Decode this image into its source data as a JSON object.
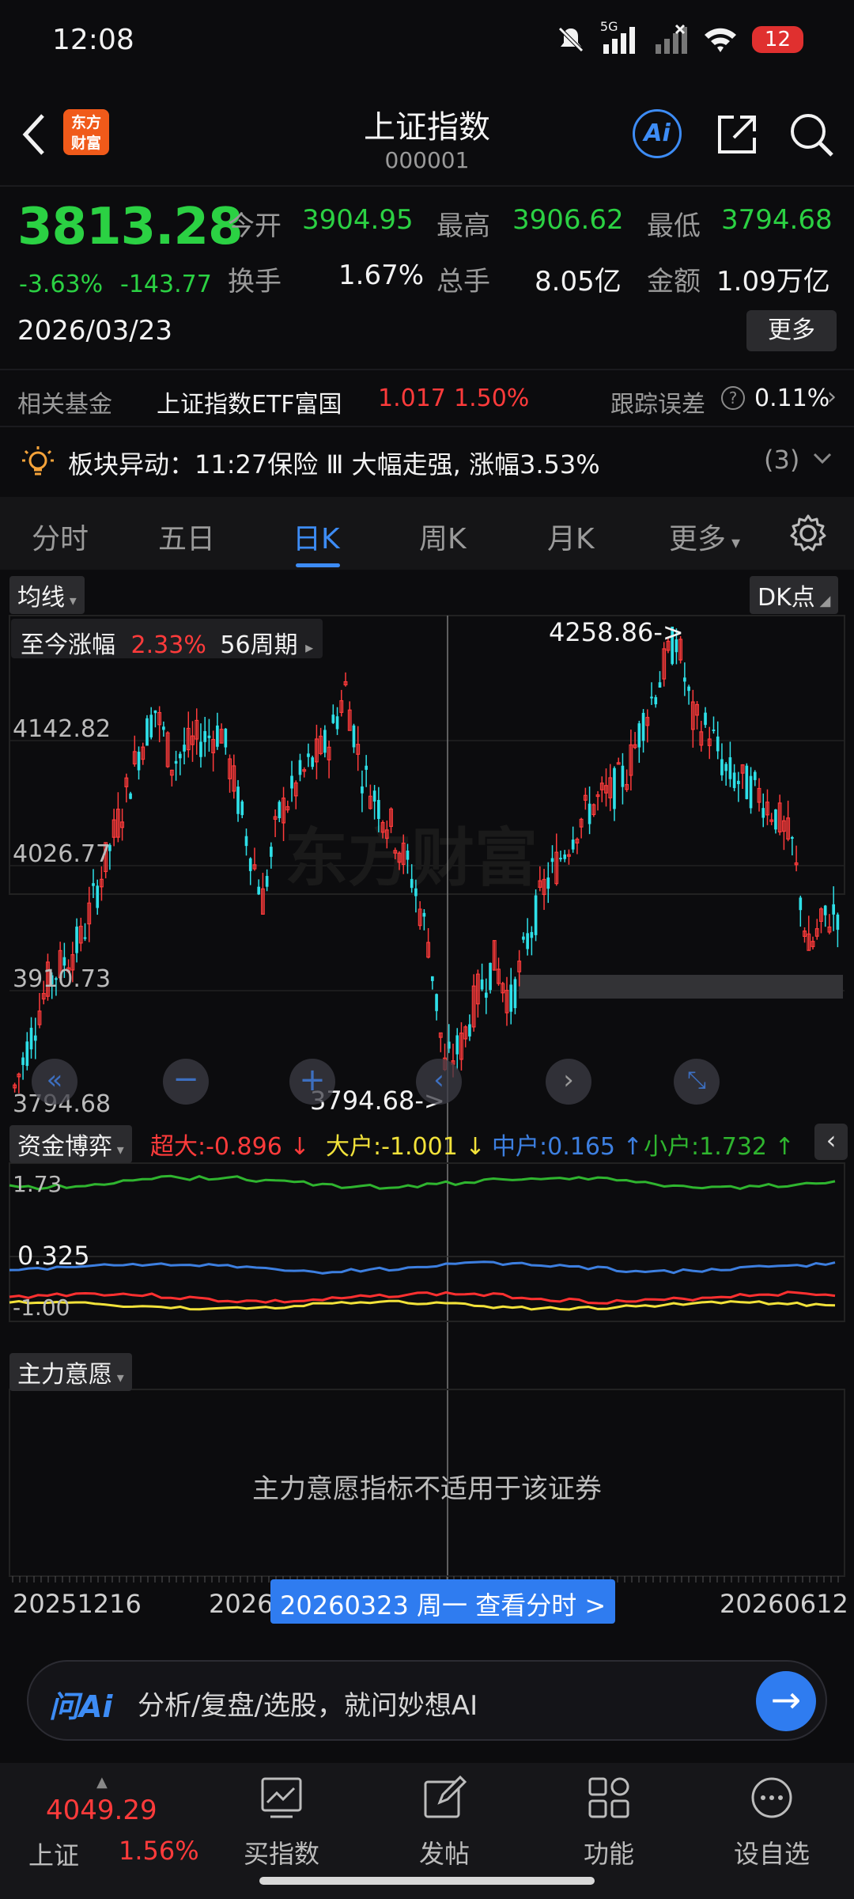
{
  "status_bar": {
    "time": "12:08",
    "network": "5G",
    "battery": "12"
  },
  "header": {
    "title": "上证指数",
    "code": "000001",
    "logo_text": "东方财富",
    "ai_label": "Ai"
  },
  "quote": {
    "price": "3813.28",
    "change_pct": "-3.63%",
    "change_abs": "-143.77",
    "date": "2026/03/23",
    "open_label": "今开",
    "open": "3904.95",
    "high_label": "最高",
    "high": "3906.62",
    "low_label": "最低",
    "low": "3794.68",
    "turnover_label": "换手",
    "turnover": "1.67%",
    "volume_label": "总手",
    "volume": "8.05亿",
    "amount_label": "金额",
    "amount": "1.09万亿",
    "more_label": "更多"
  },
  "fund": {
    "label": "相关基金",
    "name": "上证指数ETF富国",
    "price": "1.017",
    "pct": "1.50%",
    "tracking_label": "跟踪误差",
    "tracking_value": "0.11%"
  },
  "alert": {
    "text": "板块异动：11:27保险 Ⅲ 大幅走强, 涨幅3.53%",
    "count": "(3)"
  },
  "tabs": [
    "分时",
    "五日",
    "日K",
    "周K",
    "月K",
    "更多"
  ],
  "active_tab": "日K",
  "chart": {
    "ma_label": "均线",
    "dk_label": "DK点",
    "period_label": "至今涨幅",
    "period_pct": "2.33%",
    "period_count": "56周期",
    "y_ticks": [
      "4142.82",
      "4026.77",
      "3910.73",
      "3794.68"
    ],
    "high_marker": "4258.86->",
    "low_marker": "3794.68->",
    "fund_panel": {
      "label": "资金博弈",
      "super": "超大:-0.896 ↓",
      "large": "大户:-1.001 ↓",
      "medium": "中户:0.165 ↑",
      "small": "小户:1.732 ↑",
      "tick_top": "1.73",
      "tick_mid": "0.325",
      "tick_bot": "-1.00"
    },
    "will_panel": {
      "label": "主力意愿",
      "message": "主力意愿指标不适用于该证券"
    },
    "x_axis": {
      "start": "20251216",
      "mid": "2026",
      "end": "20260612",
      "cursor": "20260323 周一 查看分时 >"
    },
    "colors": {
      "up": "#ff3b3b",
      "down": "#2ee0e8",
      "green_line": "#2fb52f",
      "blue_line": "#3d7fe0",
      "red_line": "#ff3030",
      "yellow_line": "#f2e23a"
    }
  },
  "chart_data": {
    "type": "candlestick",
    "y_ticks": [
      4142.82,
      4026.77,
      3910.73,
      3794.68
    ],
    "ylim": [
      3794.68,
      4258.86
    ],
    "x_start": "20251216",
    "x_end": "20260612",
    "high": 4258.86,
    "low": 3794.68,
    "selected_date": "20260323"
  },
  "ai_bar": {
    "brand": "问Ai",
    "placeholder": "分析/复盘/选股，就问妙想AI"
  },
  "bottom_nav": {
    "index_value": "4049.29",
    "index_name": "上证",
    "index_pct": "1.56%",
    "items": [
      "买指数",
      "发帖",
      "功能",
      "设自选"
    ]
  }
}
